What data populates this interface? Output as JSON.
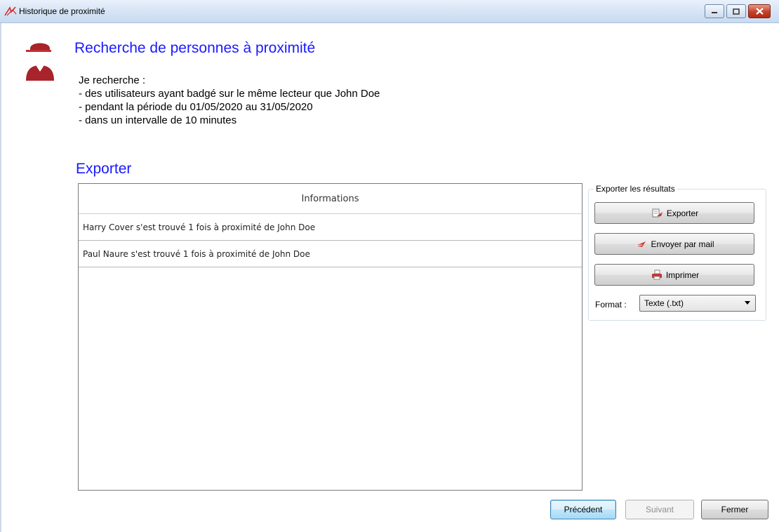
{
  "window": {
    "title": "Historique de proximité",
    "buttons": [
      "minimize",
      "maximize",
      "close"
    ]
  },
  "header": {
    "title": "Recherche de personnes à proximité",
    "icon": "user-icon"
  },
  "criteria": {
    "intro": "Je recherche :",
    "lines": [
      "- des utilisateurs ayant badgé sur le même lecteur que John Doe",
      "- pendant la période du 01/05/2020 au 31/05/2020",
      "- dans un intervalle de 10 minutes"
    ]
  },
  "export_section": {
    "title": "Exporter"
  },
  "grid": {
    "column_header": "Informations",
    "rows": [
      "Harry Cover s'est trouvé 1 fois à proximité de John Doe",
      "Paul Naure s'est trouvé 1 fois à proximité de John Doe"
    ]
  },
  "export_panel": {
    "group_title": "Exporter les résultats",
    "export_label": "Exporter",
    "mail_label": "Envoyer par mail",
    "print_label": "Imprimer",
    "format_label": "Format :",
    "format_value": "Texte (.txt)"
  },
  "footer": {
    "previous_label": "Précédent",
    "next_label": "Suivant",
    "close_label": "Fermer"
  },
  "colors": {
    "heading": "#1a1aff",
    "user_icon": "#a8242a",
    "close_button": "#c4402a"
  }
}
